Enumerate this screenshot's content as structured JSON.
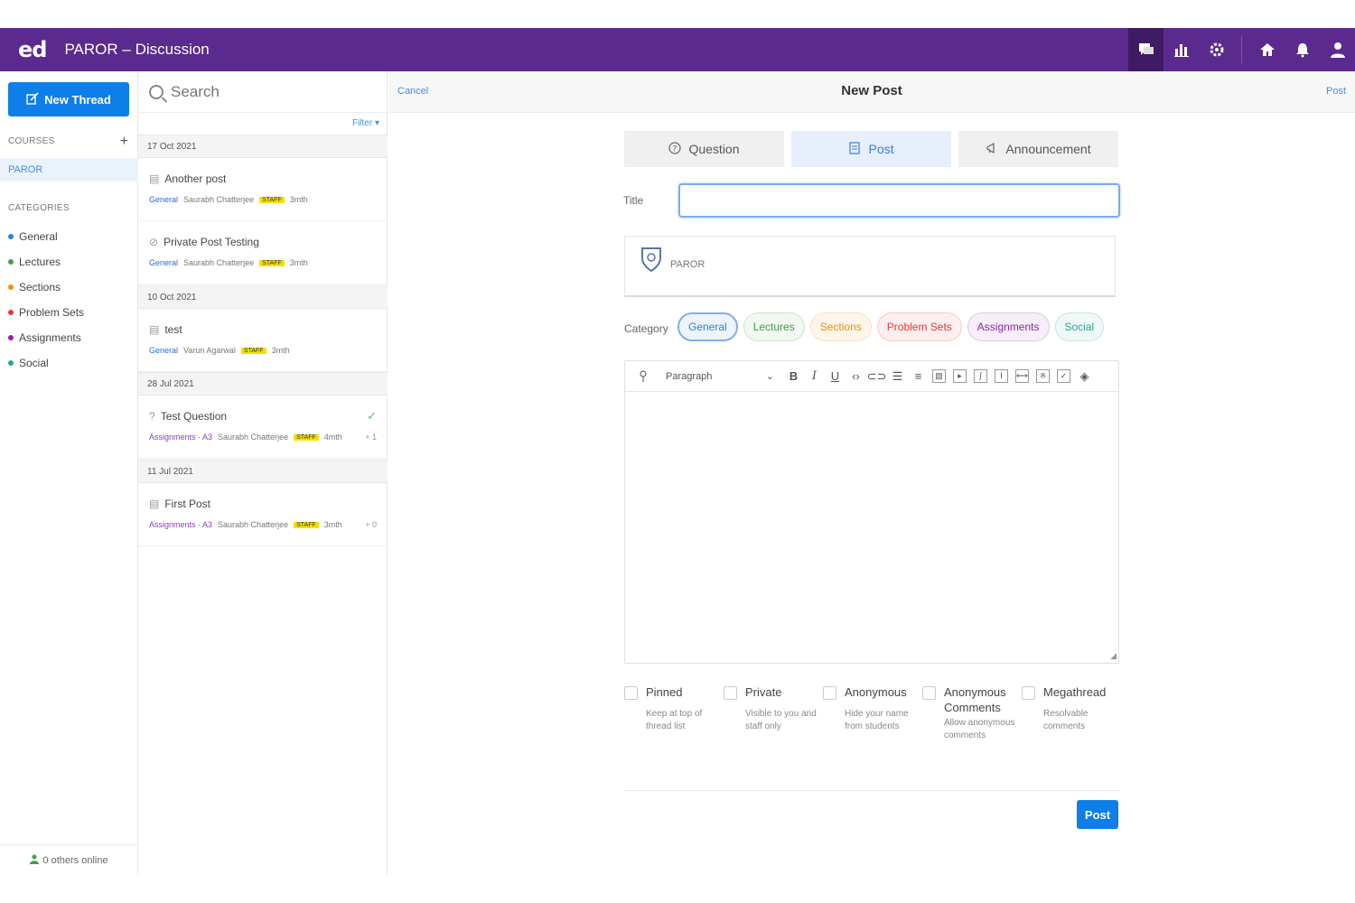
{
  "app": {
    "logo": "ed",
    "title": "PAROR – Discussion"
  },
  "topbar": {
    "icons": [
      "discussion-icon",
      "analytics-icon",
      "settings-icon",
      "home-icon",
      "bell-icon",
      "user-icon"
    ]
  },
  "sidebar": {
    "new_thread_label": "New Thread",
    "courses_heading": "COURSES",
    "course": "PAROR",
    "categories_heading": "CATEGORIES",
    "categories": [
      {
        "label": "General",
        "color": "#1e88e5"
      },
      {
        "label": "Lectures",
        "color": "#43a047"
      },
      {
        "label": "Sections",
        "color": "#fb8c00"
      },
      {
        "label": "Problem Sets",
        "color": "#e53935"
      },
      {
        "label": "Assignments",
        "color": "#8e24aa"
      },
      {
        "label": "Social",
        "color": "#26a69a"
      }
    ],
    "online": "0 others online"
  },
  "threadlist": {
    "search_placeholder": "Search",
    "filter_label": "Filter ▾",
    "groups": [
      {
        "date": "17 Oct 2021"
      },
      {
        "date": "10 Oct 2021"
      },
      {
        "date": "28 Jul 2021"
      },
      {
        "date": "11 Jul 2021"
      }
    ],
    "threads": [
      {
        "title": "Another post",
        "category": "General",
        "author": "Saurabh Chatterjee",
        "badge": "STAFF",
        "time": "3mth",
        "right": ""
      },
      {
        "title": "Private Post Testing",
        "category": "General",
        "author": "Saurabh Chatterjee",
        "badge": "STAFF",
        "time": "3mth",
        "right": ""
      },
      {
        "title": "test",
        "category": "General",
        "author": "Varun Agarwal",
        "badge": "STAFF",
        "time": "3mth",
        "right": ""
      },
      {
        "title": "Test Question",
        "category": "Assignments · A3",
        "author": "Saurabh Chatterjee",
        "badge": "STAFF",
        "time": "4mth",
        "right": "+ 1"
      },
      {
        "title": "First Post",
        "category": "Assignments · A3",
        "author": "Saurabh Chatterjee",
        "badge": "STAFF",
        "time": "3mth",
        "right": "+ 0"
      }
    ]
  },
  "main": {
    "cancel_label": "Cancel",
    "page_title": "New Post",
    "post_link": "Post",
    "types": [
      {
        "label": "Question",
        "icon": "question-icon"
      },
      {
        "label": "Post",
        "icon": "post-icon"
      },
      {
        "label": "Announcement",
        "icon": "megaphone-icon"
      }
    ],
    "active_type": "Post",
    "title_label": "Title",
    "title_value": "",
    "course_name": "PAROR",
    "category_label": "Category",
    "chips": [
      {
        "label": "General",
        "color": "#1e88e5"
      },
      {
        "label": "Lectures",
        "color": "#43a047"
      },
      {
        "label": "Sections",
        "color": "#fb8c00"
      },
      {
        "label": "Problem Sets",
        "color": "#e53935"
      },
      {
        "label": "Assignments",
        "color": "#8e24aa"
      },
      {
        "label": "Social",
        "color": "#26a69a"
      }
    ],
    "selected_chip": "General",
    "editor": {
      "paragraph_select": "Paragraph"
    },
    "options": [
      {
        "label": "Pinned",
        "desc": "Keep at top of thread list"
      },
      {
        "label": "Private",
        "desc": "Visible to you and staff only"
      },
      {
        "label": "Anonymous",
        "desc": "Hide your name from students"
      },
      {
        "label": "Anonymous Comments",
        "desc": "Allow anonymous comments"
      },
      {
        "label": "Megathread",
        "desc": "Resolvable comments"
      }
    ],
    "submit_label": "Post"
  }
}
